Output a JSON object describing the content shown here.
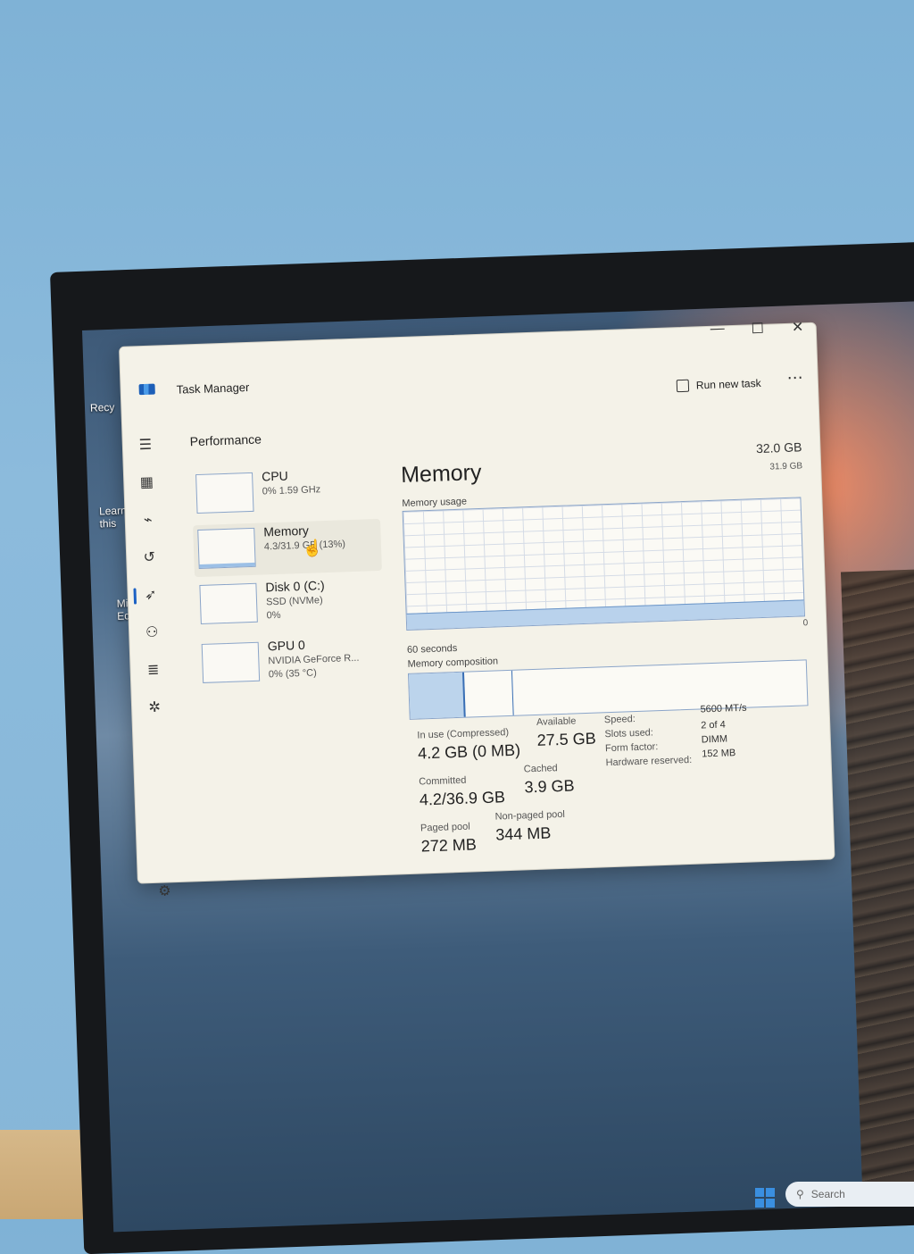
{
  "window": {
    "title": "Task Manager",
    "controls": {
      "minimize": "—",
      "maximize": "☐",
      "close": "✕"
    },
    "run_new_task": "Run new task",
    "more": "⋯"
  },
  "desktop": {
    "icons": [
      {
        "label": "Recy"
      },
      {
        "label": "Learn\nthis"
      },
      {
        "label": "Mic\nEd"
      }
    ],
    "taskbar": {
      "search": "Search"
    }
  },
  "nav": {
    "icons": [
      "hamburger-icon",
      "processes-icon",
      "performance-icon",
      "app-history-icon",
      "startup-icon",
      "users-icon",
      "details-icon",
      "services-icon"
    ],
    "settings_icon": "settings-icon"
  },
  "performance": {
    "title": "Performance",
    "items": [
      {
        "title": "CPU",
        "sub": "0% 1.59 GHz",
        "sub2": ""
      },
      {
        "title": "Memory",
        "sub": "4.3/31.9 GB (13%)",
        "sub2": ""
      },
      {
        "title": "Disk 0 (C:)",
        "sub": "SSD (NVMe)",
        "sub2": "0%"
      },
      {
        "title": "GPU 0",
        "sub": "NVIDIA GeForce R...",
        "sub2": "0% (35 °C)"
      }
    ]
  },
  "memory": {
    "title": "Memory",
    "total": "32.0 GB",
    "max_label": "31.9 GB",
    "usage_label": "Memory usage",
    "zero_label": "0",
    "time_label": "60 seconds",
    "usage_fraction": 0.13,
    "composition_label": "Memory composition",
    "composition": {
      "in_use_fraction": 0.135,
      "modified_fraction": 0.12
    },
    "stats": {
      "in_use_label": "In use (Compressed)",
      "in_use_value": "4.2 GB (0 MB)",
      "available_label": "Available",
      "available_value": "27.5 GB",
      "committed_label": "Committed",
      "committed_value": "4.2/36.9 GB",
      "cached_label": "Cached",
      "cached_value": "3.9 GB",
      "paged_label": "Paged pool",
      "paged_value": "272 MB",
      "nonpaged_label": "Non-paged pool",
      "nonpaged_value": "344 MB"
    },
    "specs": {
      "speed_label": "Speed:",
      "speed_value": "5600 MT/s",
      "slots_label": "Slots used:",
      "slots_value": "2 of 4",
      "form_label": "Form factor:",
      "form_value": "DIMM",
      "hw_label": "Hardware reserved:",
      "hw_value": "152 MB"
    }
  },
  "colors": {
    "accent": "#1d62c4",
    "graph_fill": "#b9d2ec",
    "graph_border": "#8aa4c8"
  }
}
